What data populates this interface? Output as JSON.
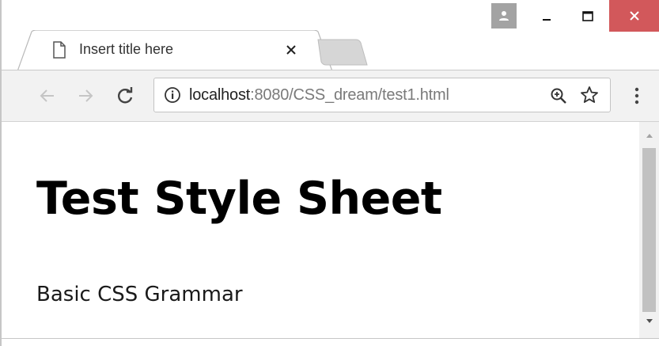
{
  "window": {
    "controls": {
      "profile_icon": "user-icon",
      "minimize_icon": "minimize-icon",
      "maximize_icon": "maximize-icon",
      "close_icon": "close-icon",
      "close_color": "#d2585b"
    }
  },
  "tab": {
    "title": "Insert title here",
    "favicon": "page-icon",
    "close_icon": "close-icon"
  },
  "toolbar": {
    "back_icon": "arrow-left-icon",
    "forward_icon": "arrow-right-icon",
    "reload_icon": "reload-icon",
    "url_host": "localhost",
    "url_rest": ":8080/CSS_dream/test1.html",
    "info_icon": "info-icon",
    "zoom_icon": "zoom-in-icon",
    "bookmark_icon": "star-icon",
    "menu_icon": "more-vert-icon"
  },
  "page": {
    "heading": "Test Style Sheet",
    "text": "Basic CSS Grammar"
  },
  "scrollbar": {
    "thumb_color": "#c1c1c1"
  }
}
